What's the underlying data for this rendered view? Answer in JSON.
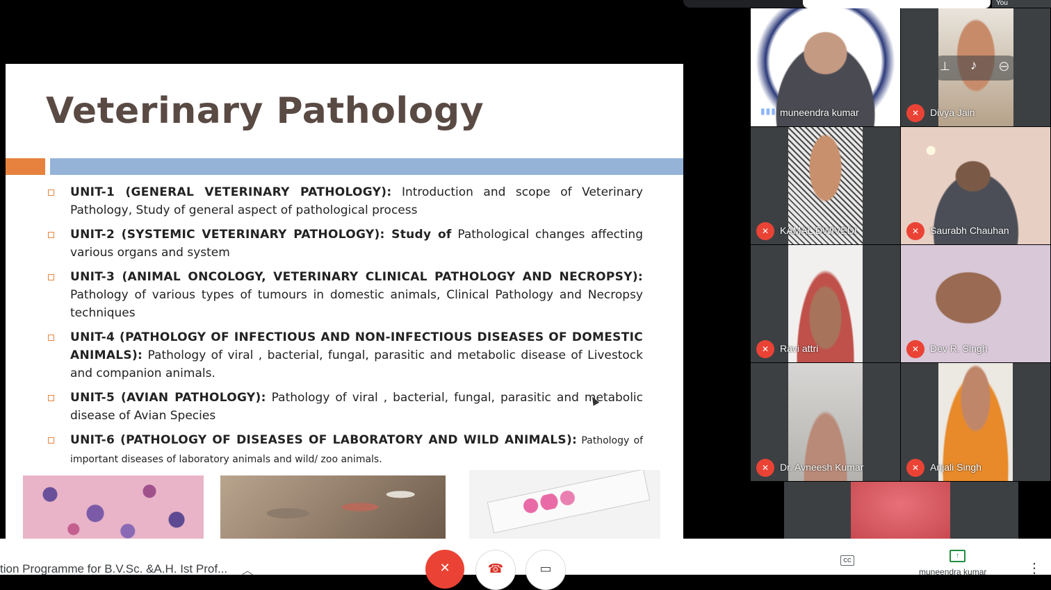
{
  "slide": {
    "title": "Veterinary Pathology",
    "units": [
      {
        "head": "UNIT-1 (GENERAL VETERINARY PATHOLOGY):",
        "desc": " Introduction and scope of Veterinary Pathology, Study of general aspect of pathological process"
      },
      {
        "head": "UNIT-2 (SYSTEMIC VETERINARY PATHOLOGY): Study of",
        "desc": " Pathological changes affecting various organs and system"
      },
      {
        "head": "UNIT-3 (ANIMAL ONCOLOGY, VETERINARY CLINICAL PATHOLOGY AND NECROPSY):",
        "desc": " Pathology of various types of tumours in domestic animals, Clinical Pathology and Necropsy techniques"
      },
      {
        "head": "UNIT-4 (PATHOLOGY OF INFECTIOUS AND NON-INFECTIOUS DISEASES OF DOMESTIC ANIMALS):",
        "desc": " Pathology of viral , bacterial, fungal, parasitic and metabolic disease of Livestock and companion animals."
      },
      {
        "head": "UNIT-5 (AVIAN PATHOLOGY):",
        "desc": " Pathology of viral , bacterial, fungal, parasitic and metabolic disease of Avian Species"
      },
      {
        "head": "UNIT-6 (PATHOLOGY OF DISEASES OF LABORATORY AND WILD ANIMALS):",
        "desc": " Pathology of important diseases of laboratory animals and wild/ zoo animals."
      }
    ]
  },
  "participants": [
    {
      "name": "muneendra kumar"
    },
    {
      "name": "Divya Jain"
    },
    {
      "name": "KAMAL DWIVEDI"
    },
    {
      "name": "Saurabh Chauhan"
    },
    {
      "name": "Ravi attri"
    },
    {
      "name": "Dev R. Singh"
    },
    {
      "name": "Dr. Avneesh Kumar"
    },
    {
      "name": "Anjali Singh"
    }
  ],
  "topbar": {
    "self_label": "You"
  },
  "icons": {
    "mic_off": "mic-off-icon",
    "pin": "pin-icon",
    "remove": "remove-icon",
    "hangup": "hangup-icon",
    "camera": "camera-icon",
    "captions": "captions-icon",
    "present": "present-icon",
    "more": "more-vert-icon"
  },
  "colors": {
    "mic_off_red": "#ea4335",
    "accent_orange": "#e6823e",
    "accent_blue": "#95b3d7",
    "present_green": "#1e8e3e"
  },
  "bottombar": {
    "meeting_title": "tion Programme for B.V.Sc. &A.H. Ist Prof...",
    "cc_label": "CC",
    "presenter_label": "muneendra kumar"
  }
}
